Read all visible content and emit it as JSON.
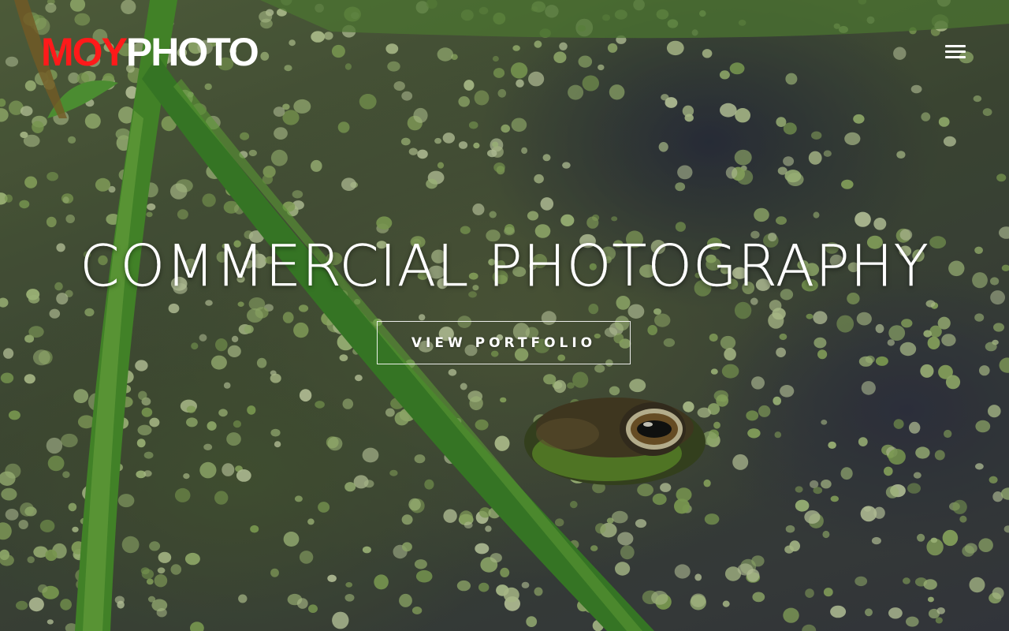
{
  "header": {
    "logo_part1": "MOY",
    "logo_part2": "PHOTO",
    "menu_icon": "hamburger-menu-icon"
  },
  "hero": {
    "title": "COMMERCIAL PHOTOGRAPHY",
    "cta_label": "VIEW PORTFOLIO",
    "background_subject": "frog in duckweed pond with grass blades"
  },
  "colors": {
    "logo_accent": "#ff1a1a",
    "logo_text": "#ffffff",
    "headline": "#ffffff",
    "cta_border": "#ffffff"
  }
}
